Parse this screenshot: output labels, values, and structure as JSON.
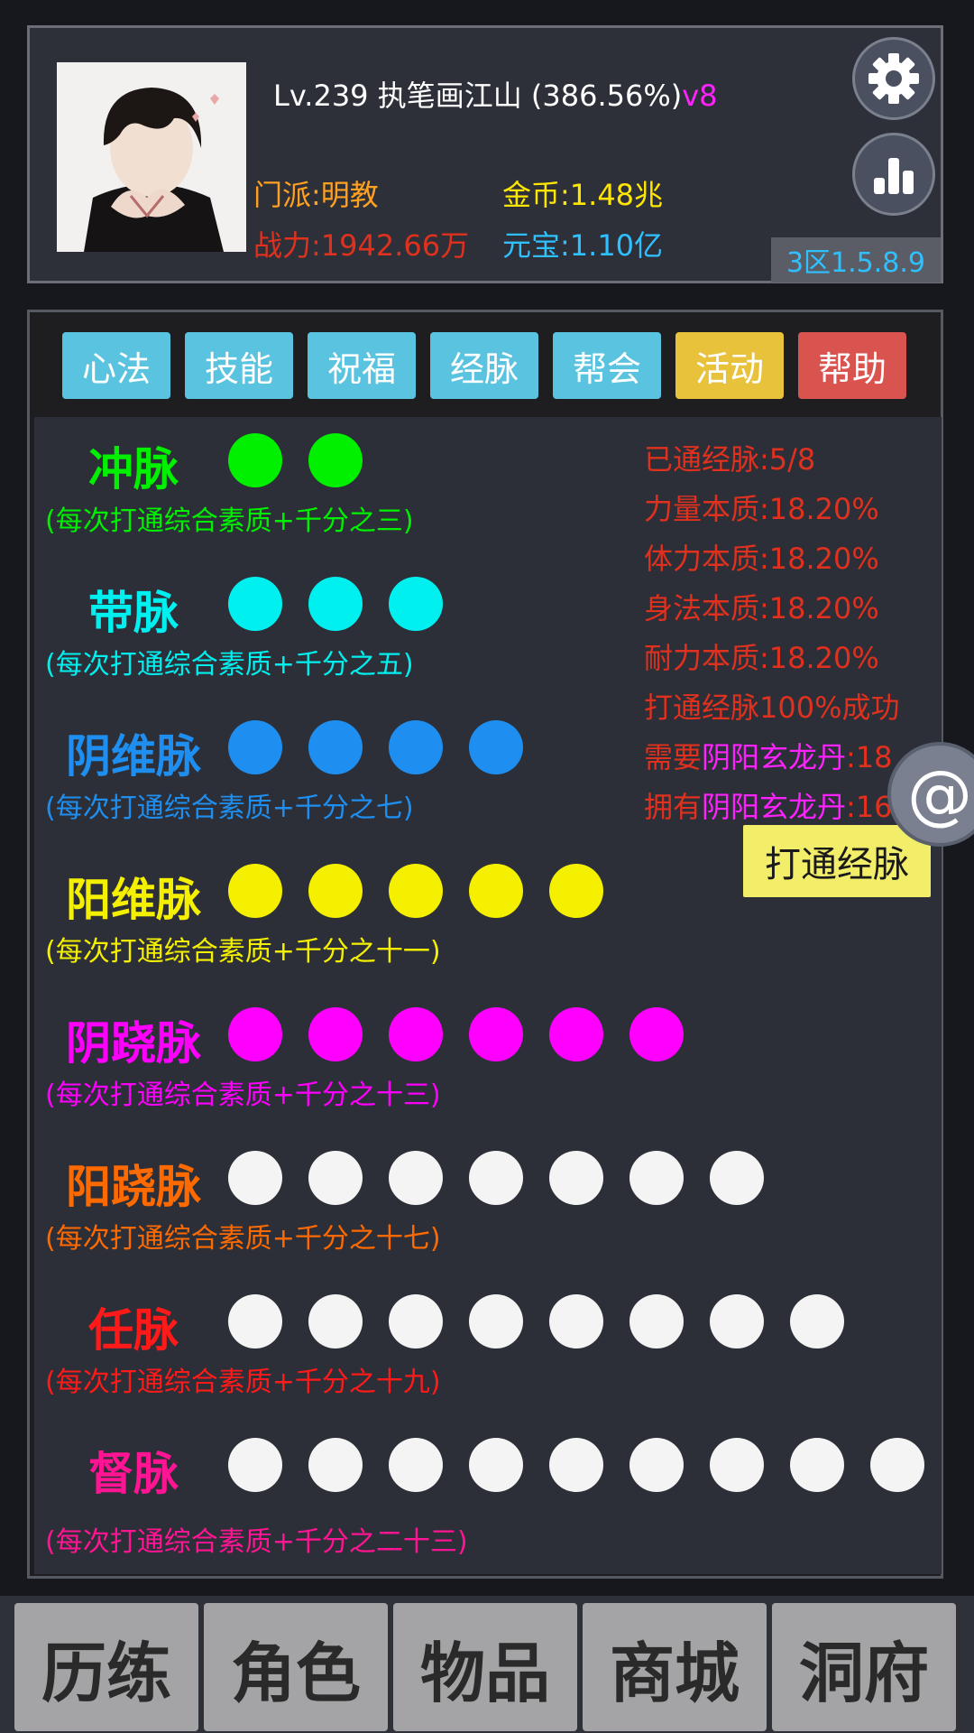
{
  "player": {
    "level": "Lv.239",
    "name": "执笔画江山",
    "exp_percent": "(386.56%)",
    "vip": "v8",
    "sect": "门派:明教",
    "power": "战力:1942.66万",
    "gold": "金币:1.48兆",
    "ingot": "元宝:1.10亿",
    "server": "3区1.5.8.9"
  },
  "header_buttons": {
    "settings_icon": "gear-icon",
    "ranking_icon": "bar-chart-icon"
  },
  "tabs": [
    {
      "label": "心法",
      "color": "#5ac3e0"
    },
    {
      "label": "技能",
      "color": "#5ac3e0"
    },
    {
      "label": "祝福",
      "color": "#5ac3e0"
    },
    {
      "label": "经脉",
      "color": "#5ac3e0"
    },
    {
      "label": "帮会",
      "color": "#5ac3e0"
    },
    {
      "label": "活动",
      "color": "#e8c23a"
    },
    {
      "label": "帮助",
      "color": "#d9534f"
    }
  ],
  "meridians": [
    {
      "name": "冲脉",
      "color": "#00f000",
      "desc": "(每次打通综合素质+千分之三)",
      "total": 2,
      "opened": 2
    },
    {
      "name": "带脉",
      "color": "#00f0f0",
      "desc": "(每次打通综合素质+千分之五)",
      "total": 3,
      "opened": 3
    },
    {
      "name": "阴维脉",
      "color": "#1e8ff0",
      "desc": "(每次打通综合素质+千分之七)",
      "total": 4,
      "opened": 4
    },
    {
      "name": "阳维脉",
      "color": "#f5f000",
      "desc": "(每次打通综合素质+千分之十一)",
      "total": 5,
      "opened": 5
    },
    {
      "name": "阴跷脉",
      "color": "#ff00ff",
      "desc": "(每次打通综合素质+千分之十三)",
      "total": 6,
      "opened": 6
    },
    {
      "name": "阳跷脉",
      "color": "#ff6a00",
      "desc": "(每次打通综合素质+千分之十七)",
      "total": 7,
      "opened": 0
    },
    {
      "name": "任脉",
      "color": "#ff1a1a",
      "desc": "(每次打通综合素质+千分之十九)",
      "total": 8,
      "opened": 0
    },
    {
      "name": "督脉",
      "color": "#ff1493",
      "desc": "(每次打通综合素质+千分之二十三)",
      "total": 9,
      "opened": 0
    }
  ],
  "info": {
    "opened": "已通经脉:5/8",
    "strength": "力量本质:18.20%",
    "stamina": "体力本质:18.20%",
    "agility": "身法本质:18.20%",
    "endurance": "耐力本质:18.20%",
    "success": "打通经脉100%成功",
    "need_prefix": "需要",
    "need_item": "阴阳玄龙丹",
    "need_value": ":18",
    "have_prefix": "拥有",
    "have_item": "阴阳玄龙丹",
    "have_value": ":16"
  },
  "open_button": "打通经脉",
  "float_button": "@",
  "nav": [
    "历练",
    "角色",
    "物品",
    "商城",
    "洞府"
  ]
}
